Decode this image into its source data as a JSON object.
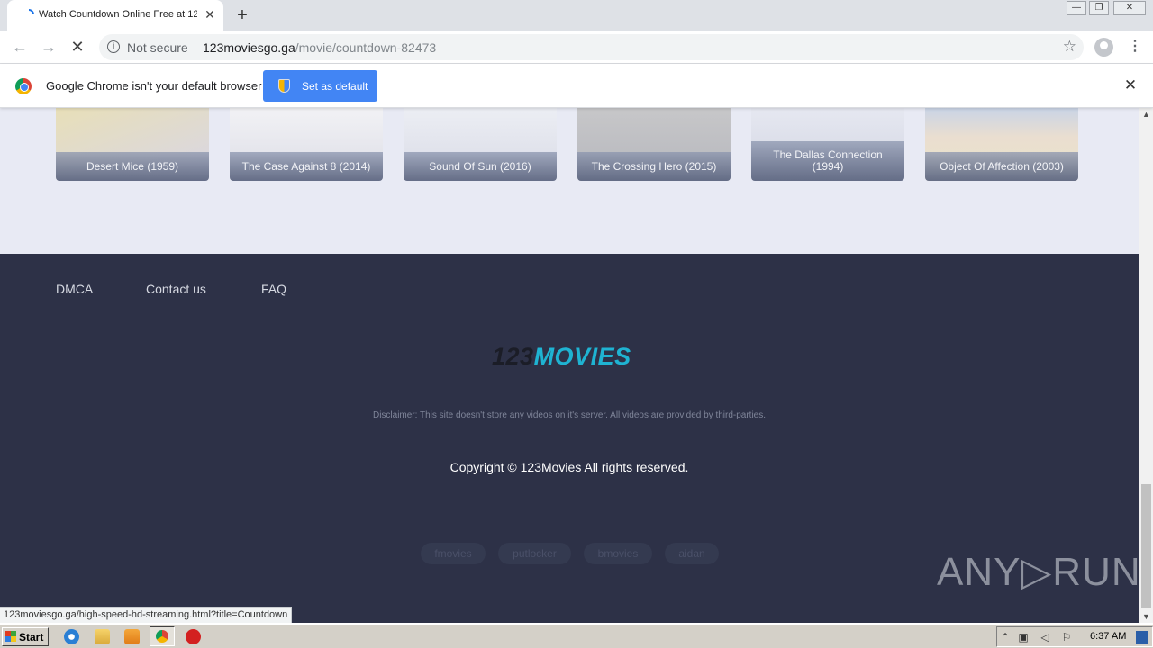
{
  "browser": {
    "tab_title": "Watch Countdown Online Free at 12",
    "tab_close": "✕",
    "new_tab": "+",
    "window_buttons": [
      "—",
      "❐",
      "✕"
    ],
    "security_label": "Not secure",
    "url_host": "123moviesgo.ga",
    "url_path": "/movie/countdown-82473",
    "star": "☆",
    "menu": "⋮",
    "back": "←",
    "forward": "→",
    "reload": "✕",
    "infobar_text": "Google Chrome isn't your default browser",
    "set_default_label": "Set as default",
    "infobar_close": "✕"
  },
  "related": [
    {
      "title": "Desert Mice (1959)"
    },
    {
      "title": "The Case Against 8 (2014)"
    },
    {
      "title": "Sound Of Sun (2016)"
    },
    {
      "title": "The Crossing Hero (2015)"
    },
    {
      "title": "The Dallas Connection (1994)"
    },
    {
      "title": "Object Of Affection (2003)"
    }
  ],
  "footer": {
    "links": [
      "DMCA",
      "Contact us",
      "FAQ"
    ],
    "logo_num": "123",
    "logo_word": "MOVIES",
    "disclaimer": "Disclaimer: This site doesn't store any videos on it's server. All videos are provided by third-parties.",
    "copyright": "Copyright © 123Movies All rights reserved.",
    "tags": [
      "fmovies",
      "putlocker",
      "bmovies",
      "aidan"
    ]
  },
  "watermark": "ANY▷RUN",
  "status_url": "123moviesgo.ga/high-speed-hd-streaming.html?title=Countdown",
  "taskbar": {
    "start_label": "Start",
    "clock": "6:37 AM"
  }
}
